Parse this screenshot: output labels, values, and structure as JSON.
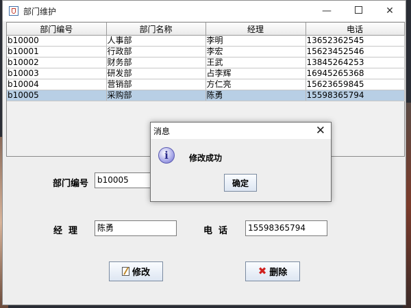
{
  "window": {
    "title": "部门维护"
  },
  "table": {
    "columns": [
      "部门编号",
      "部门名称",
      "经理",
      "电话"
    ],
    "rows": [
      [
        "b10000",
        "人事部",
        "李明",
        "13652362545"
      ],
      [
        "b10001",
        "行政部",
        "李宏",
        "15623452546"
      ],
      [
        "b10002",
        "财务部",
        "王武",
        "13845264253"
      ],
      [
        "b10003",
        "研发部",
        "占李辉",
        "16945265368"
      ],
      [
        "b10004",
        "营销部",
        "方仁亮",
        "15623659845"
      ],
      [
        "b10005",
        "采购部",
        "陈勇",
        "15598365794"
      ]
    ],
    "selected_row": 5
  },
  "form": {
    "dept_id_label": "部门编号",
    "dept_id_value": "b10005",
    "manager_label": "经  理",
    "manager_value": "陈勇",
    "phone_label": "电  话",
    "phone_value": "15598365794"
  },
  "buttons": {
    "edit": "修改",
    "delete": "删除"
  },
  "dialog": {
    "title": "消息",
    "message": "修改成功",
    "ok": "确定"
  },
  "icons": [
    "java-app-icon",
    "minimize-icon",
    "maximize-icon",
    "close-icon",
    "edit-icon",
    "delete-icon",
    "info-icon"
  ],
  "colors": {
    "selected_row": "#b8cfe5",
    "delete_icon": "#d0201e"
  }
}
